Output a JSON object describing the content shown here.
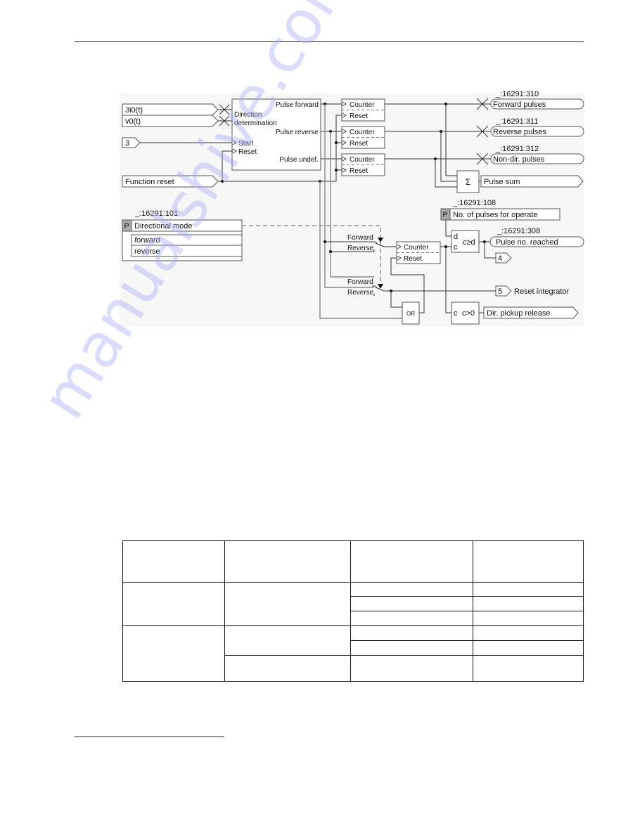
{
  "diagram": {
    "inputs": {
      "i0": "3i0(t)",
      "v0": "v0(t)",
      "start_const": "3",
      "function_reset": "Function reset"
    },
    "direction_block": {
      "title_line1": "Direction",
      "title_line2": "determination",
      "in_start": "Start",
      "in_reset": "Reset",
      "out_forward": "Pulse forward",
      "out_reverse": "Pulse reverse",
      "out_undef": "Pulse undef."
    },
    "counters": [
      {
        "counter": "Counter",
        "reset": "Reset"
      },
      {
        "counter": "Counter",
        "reset": "Reset"
      },
      {
        "counter": "Counter",
        "reset": "Reset"
      },
      {
        "counter": "Counter",
        "reset": "Reset"
      }
    ],
    "outputs": [
      {
        "id": "_:16291:310",
        "label": "Forward pulses"
      },
      {
        "id": "_:16291:311",
        "label": "Reverse pulses"
      },
      {
        "id": "_:16291:312",
        "label": "Non-dir. pulses"
      }
    ],
    "sum_block": {
      "symbol": "Σ",
      "output": "Pulse sum"
    },
    "param_pulses": {
      "id": "_:16291:108",
      "badge": "P",
      "label": "No. of pulses for operate"
    },
    "compare_block": {
      "in_d": "d",
      "in_c": "c",
      "op": "c≥d"
    },
    "pulse_reached": {
      "id": "_:16291:308",
      "label": "Pulse no. reached"
    },
    "connector_4": "4",
    "connector_5": "5",
    "reset_integrator": "Reset integrator",
    "or_gate": "OR",
    "pickup_block": {
      "in_c": "c",
      "op": "c>0",
      "output": "Dir. pickup release"
    },
    "param_mode": {
      "id": "_:16291:101",
      "badge": "P",
      "label": "Directional mode",
      "options": [
        "forward",
        "reverse"
      ],
      "selected": "forward"
    },
    "switch1": {
      "forward": "Forward",
      "reverse": "Reverse"
    },
    "switch2": {
      "forward": "Forward",
      "reverse": "Reverse"
    }
  },
  "table": {
    "rows": [
      [
        "",
        "",
        "",
        ""
      ],
      [
        "",
        "",
        "",
        ""
      ],
      [
        "",
        "",
        ""
      ],
      [
        "",
        "",
        ""
      ],
      [
        "",
        "",
        "",
        ""
      ],
      [
        "",
        ""
      ],
      [
        "",
        "",
        ""
      ]
    ]
  },
  "watermark": "manualshive.com"
}
